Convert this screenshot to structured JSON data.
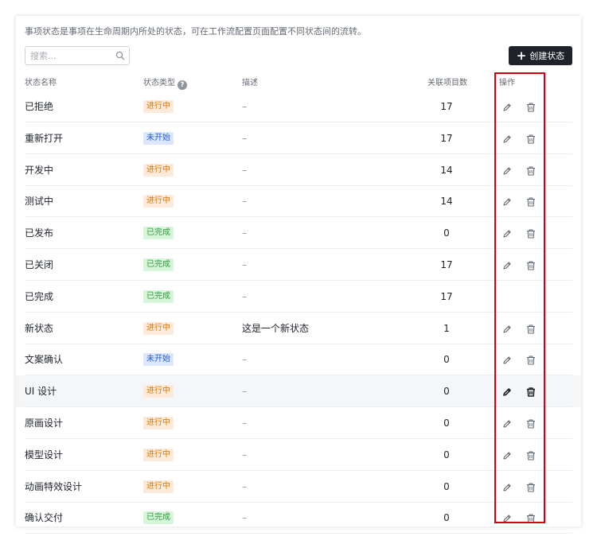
{
  "description": "事项状态是事项在生命周期内所处的状态，可在工作流配置页面配置不同状态间的流转。",
  "search": {
    "placeholder": "搜索..."
  },
  "create_button": "创建状态",
  "columns": {
    "name": "状态名称",
    "type": "状态类型",
    "description": "描述",
    "count": "关联项目数",
    "actions": "操作"
  },
  "colors": {
    "in_progress_bg": "#feeadb",
    "in_progress_fg": "#de7802",
    "not_started_bg": "#dbe7fe",
    "not_started_fg": "#245bdb",
    "done_bg": "#d5f6d9",
    "done_fg": "#2c9e3b",
    "highlight_border": "#d4000f"
  },
  "rows": [
    {
      "name": "已拒绝",
      "type": "进行中",
      "kind": "inprog",
      "desc": "–",
      "count": "17",
      "actions": true
    },
    {
      "name": "重新打开",
      "type": "未开始",
      "kind": "notstart",
      "desc": "–",
      "count": "17",
      "actions": true
    },
    {
      "name": "开发中",
      "type": "进行中",
      "kind": "inprog",
      "desc": "–",
      "count": "14",
      "actions": true
    },
    {
      "name": "测试中",
      "type": "进行中",
      "kind": "inprog",
      "desc": "–",
      "count": "14",
      "actions": true
    },
    {
      "name": "已发布",
      "type": "已完成",
      "kind": "done",
      "desc": "–",
      "count": "0",
      "actions": true
    },
    {
      "name": "已关闭",
      "type": "已完成",
      "kind": "done",
      "desc": "–",
      "count": "17",
      "actions": true
    },
    {
      "name": "已完成",
      "type": "已完成",
      "kind": "done",
      "desc": "–",
      "count": "17",
      "actions": false
    },
    {
      "name": "新状态",
      "type": "进行中",
      "kind": "inprog",
      "desc": "这是一个新状态",
      "count": "1",
      "actions": true
    },
    {
      "name": "文案确认",
      "type": "未开始",
      "kind": "notstart",
      "desc": "–",
      "count": "0",
      "actions": true
    },
    {
      "name": "UI 设计",
      "type": "进行中",
      "kind": "inprog",
      "desc": "–",
      "count": "0",
      "actions": true,
      "hover": true
    },
    {
      "name": "原画设计",
      "type": "进行中",
      "kind": "inprog",
      "desc": "–",
      "count": "0",
      "actions": true
    },
    {
      "name": "模型设计",
      "type": "进行中",
      "kind": "inprog",
      "desc": "–",
      "count": "0",
      "actions": true
    },
    {
      "name": "动画特效设计",
      "type": "进行中",
      "kind": "inprog",
      "desc": "–",
      "count": "0",
      "actions": true
    },
    {
      "name": "确认交付",
      "type": "已完成",
      "kind": "done",
      "desc": "–",
      "count": "0",
      "actions": true
    }
  ]
}
